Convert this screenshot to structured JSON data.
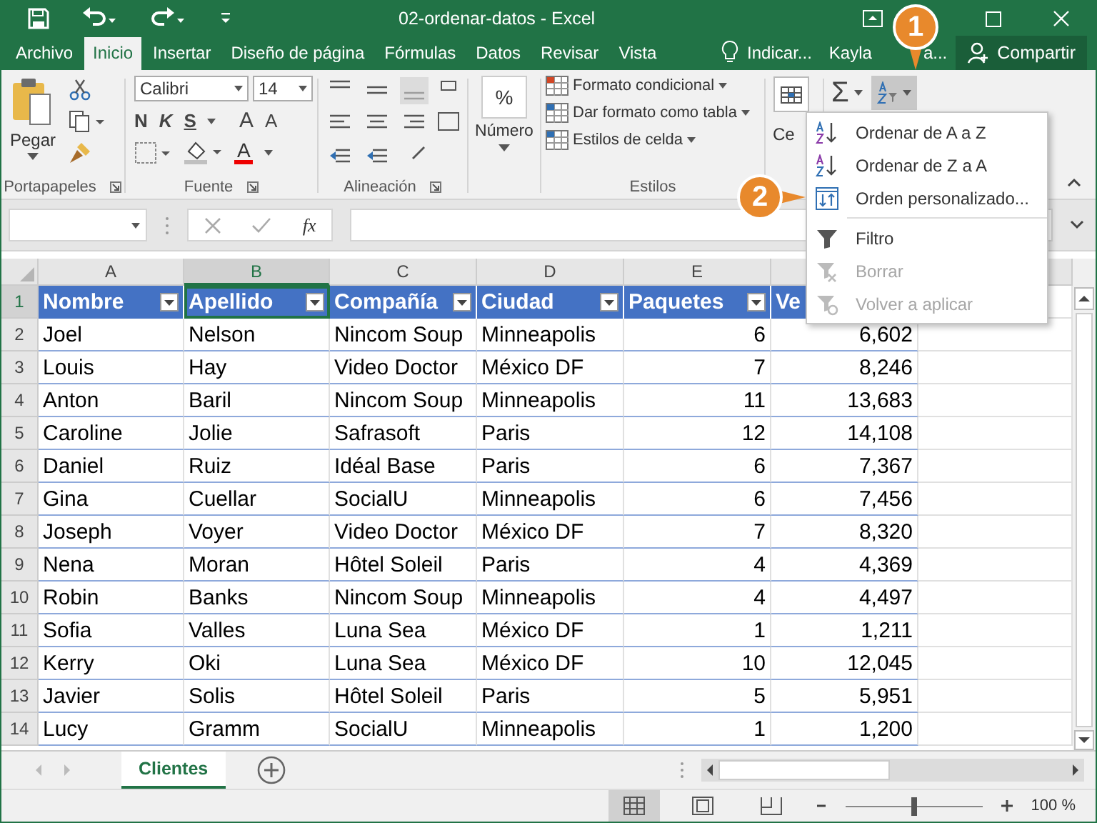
{
  "window": {
    "title": "02-ordenar-datos  -  Excel"
  },
  "tabs": [
    {
      "label": "Archivo",
      "selected": false
    },
    {
      "label": "Inicio",
      "selected": true
    },
    {
      "label": "Insertar",
      "selected": false
    },
    {
      "label": "Diseño de página",
      "selected": false
    },
    {
      "label": "Fórmulas",
      "selected": false
    },
    {
      "label": "Datos",
      "selected": false
    },
    {
      "label": "Revisar",
      "selected": false
    },
    {
      "label": "Vista",
      "selected": false
    }
  ],
  "tell_me": "Indicar...",
  "user_name": [
    "Kayla",
    "a..."
  ],
  "share_button": "Compartir",
  "ribbon": {
    "paste": "Pegar",
    "font": "Calibri",
    "size": "14",
    "bold": "N",
    "italic": "K",
    "underline": "S",
    "grow": "A",
    "shrink": "A",
    "font_color": "A",
    "percent": "%",
    "number": "Número",
    "styles": [
      "Formato condicional",
      "Dar formato como tabla",
      "Estilos de celda"
    ],
    "cells": "Ce",
    "sum": "Σ",
    "groups": [
      "Portapapeles",
      "Fuente",
      "Alineación",
      "Estilos"
    ]
  },
  "formula_bar": {
    "fx": "fx"
  },
  "columns": [
    {
      "label": "A",
      "selected": false
    },
    {
      "label": "B",
      "selected": true
    },
    {
      "label": "C",
      "selected": false
    },
    {
      "label": "D",
      "selected": false
    },
    {
      "label": "E",
      "selected": false
    }
  ],
  "header_row": {
    "number": "1",
    "selected": true,
    "cells": [
      "Nombre",
      "Apellido",
      "Compañía",
      "Ciudad",
      "Paquetes",
      "Ve"
    ]
  },
  "rows": [
    {
      "number": "2",
      "cells": [
        "Joel",
        "Nelson",
        "Nincom Soup",
        "Minneapolis",
        "6",
        "6,602"
      ]
    },
    {
      "number": "3",
      "cells": [
        "Louis",
        "Hay",
        "Video Doctor",
        "México DF",
        "7",
        "8,246"
      ]
    },
    {
      "number": "4",
      "cells": [
        "Anton",
        "Baril",
        "Nincom Soup",
        "Minneapolis",
        "11",
        "13,683"
      ]
    },
    {
      "number": "5",
      "cells": [
        "Caroline",
        "Jolie",
        "Safrasoft",
        "Paris",
        "12",
        "14,108"
      ]
    },
    {
      "number": "6",
      "cells": [
        "Daniel",
        "Ruiz",
        "Idéal Base",
        "Paris",
        "6",
        "7,367"
      ]
    },
    {
      "number": "7",
      "cells": [
        "Gina",
        "Cuellar",
        "SocialU",
        "Minneapolis",
        "6",
        "7,456"
      ]
    },
    {
      "number": "8",
      "cells": [
        "Joseph",
        "Voyer",
        "Video Doctor",
        "México DF",
        "7",
        "8,320"
      ]
    },
    {
      "number": "9",
      "cells": [
        "Nena",
        "Moran",
        "Hôtel Soleil",
        "Paris",
        "4",
        "4,369"
      ]
    },
    {
      "number": "10",
      "cells": [
        "Robin",
        "Banks",
        "Nincom Soup",
        "Minneapolis",
        "4",
        "4,497"
      ]
    },
    {
      "number": "11",
      "cells": [
        "Sofia",
        "Valles",
        "Luna Sea",
        "México DF",
        "1",
        "1,211"
      ]
    },
    {
      "number": "12",
      "cells": [
        "Kerry",
        "Oki",
        "Luna Sea",
        "México DF",
        "10",
        "12,045"
      ]
    },
    {
      "number": "13",
      "cells": [
        "Javier",
        "Solis",
        "Hôtel Soleil",
        "Paris",
        "5",
        "5,951"
      ]
    },
    {
      "number": "14",
      "cells": [
        "Lucy",
        "Gramm",
        "SocialU",
        "Minneapolis",
        "1",
        "1,200"
      ]
    }
  ],
  "sort_menu": [
    {
      "kind": "sort-az",
      "label": "Ordenar de A a Z",
      "disabled": false
    },
    {
      "kind": "sort-za",
      "label": "Ordenar de Z a A",
      "disabled": false
    },
    {
      "kind": "custom",
      "label": "Orden personalizado...",
      "disabled": false
    },
    {
      "kind": "filter",
      "label": "Filtro",
      "disabled": false
    },
    {
      "kind": "clear",
      "label": "Borrar",
      "disabled": true
    },
    {
      "kind": "reapply",
      "label": "Volver a aplicar",
      "disabled": true
    }
  ],
  "callouts": [
    "1",
    "2"
  ],
  "sheets": [
    {
      "label": "Clientes",
      "selected": true
    }
  ],
  "zoom": {
    "level": 0.5,
    "reading": "100 %"
  }
}
